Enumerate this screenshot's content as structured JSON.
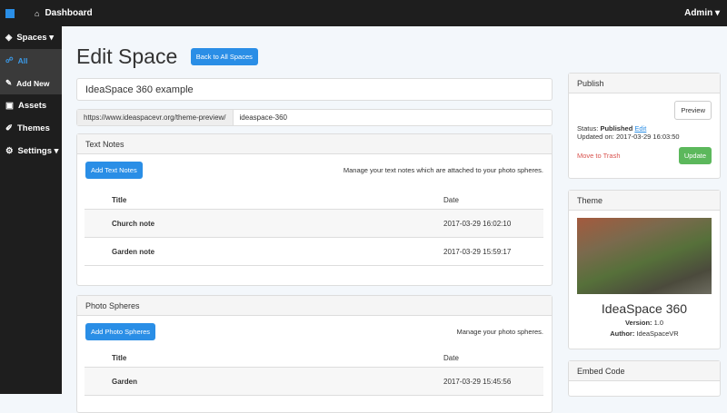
{
  "topbar": {
    "title": "Dashboard",
    "user": "Admin ▾"
  },
  "sidebar": {
    "spaces": "Spaces ▾",
    "all": "All",
    "add_new": "Add New",
    "assets": "Assets",
    "themes": "Themes",
    "settings": "Settings ▾"
  },
  "main": {
    "heading": "Edit Space",
    "back": "Back to All Spaces",
    "title_value": "IdeaSpace 360 example",
    "url_prefix": "https://www.ideaspacevr.org/theme-preview/",
    "url_slug": "ideaspace-360",
    "text_notes": {
      "title": "Text Notes",
      "add": "Add Text Notes",
      "hint": "Manage your text notes which are attached to your photo spheres.",
      "cols": [
        "Title",
        "Date"
      ],
      "rows": [
        [
          "Church note",
          "2017-03-29 16:02:10"
        ],
        [
          "Garden note",
          "2017-03-29 15:59:17"
        ]
      ]
    },
    "photo_spheres": {
      "title": "Photo Spheres",
      "add": "Add Photo Spheres",
      "hint": "Manage your photo spheres.",
      "cols": [
        "Title",
        "Date"
      ],
      "rows": [
        [
          "Garden",
          "2017-03-29 15:45:56"
        ]
      ]
    }
  },
  "publish": {
    "title": "Publish",
    "preview": "Preview",
    "status_label": "Status:",
    "status": "Published",
    "edit": "Edit",
    "updated": "Updated on: 2017-03-29 16:03:50",
    "trash": "Move to Trash",
    "update": "Update"
  },
  "theme": {
    "title": "Theme",
    "name": "IdeaSpace 360",
    "version_label": "Version:",
    "version": "1.0",
    "author_label": "Author:",
    "author": "IdeaSpaceVR"
  },
  "embed": {
    "title": "Embed Code"
  }
}
